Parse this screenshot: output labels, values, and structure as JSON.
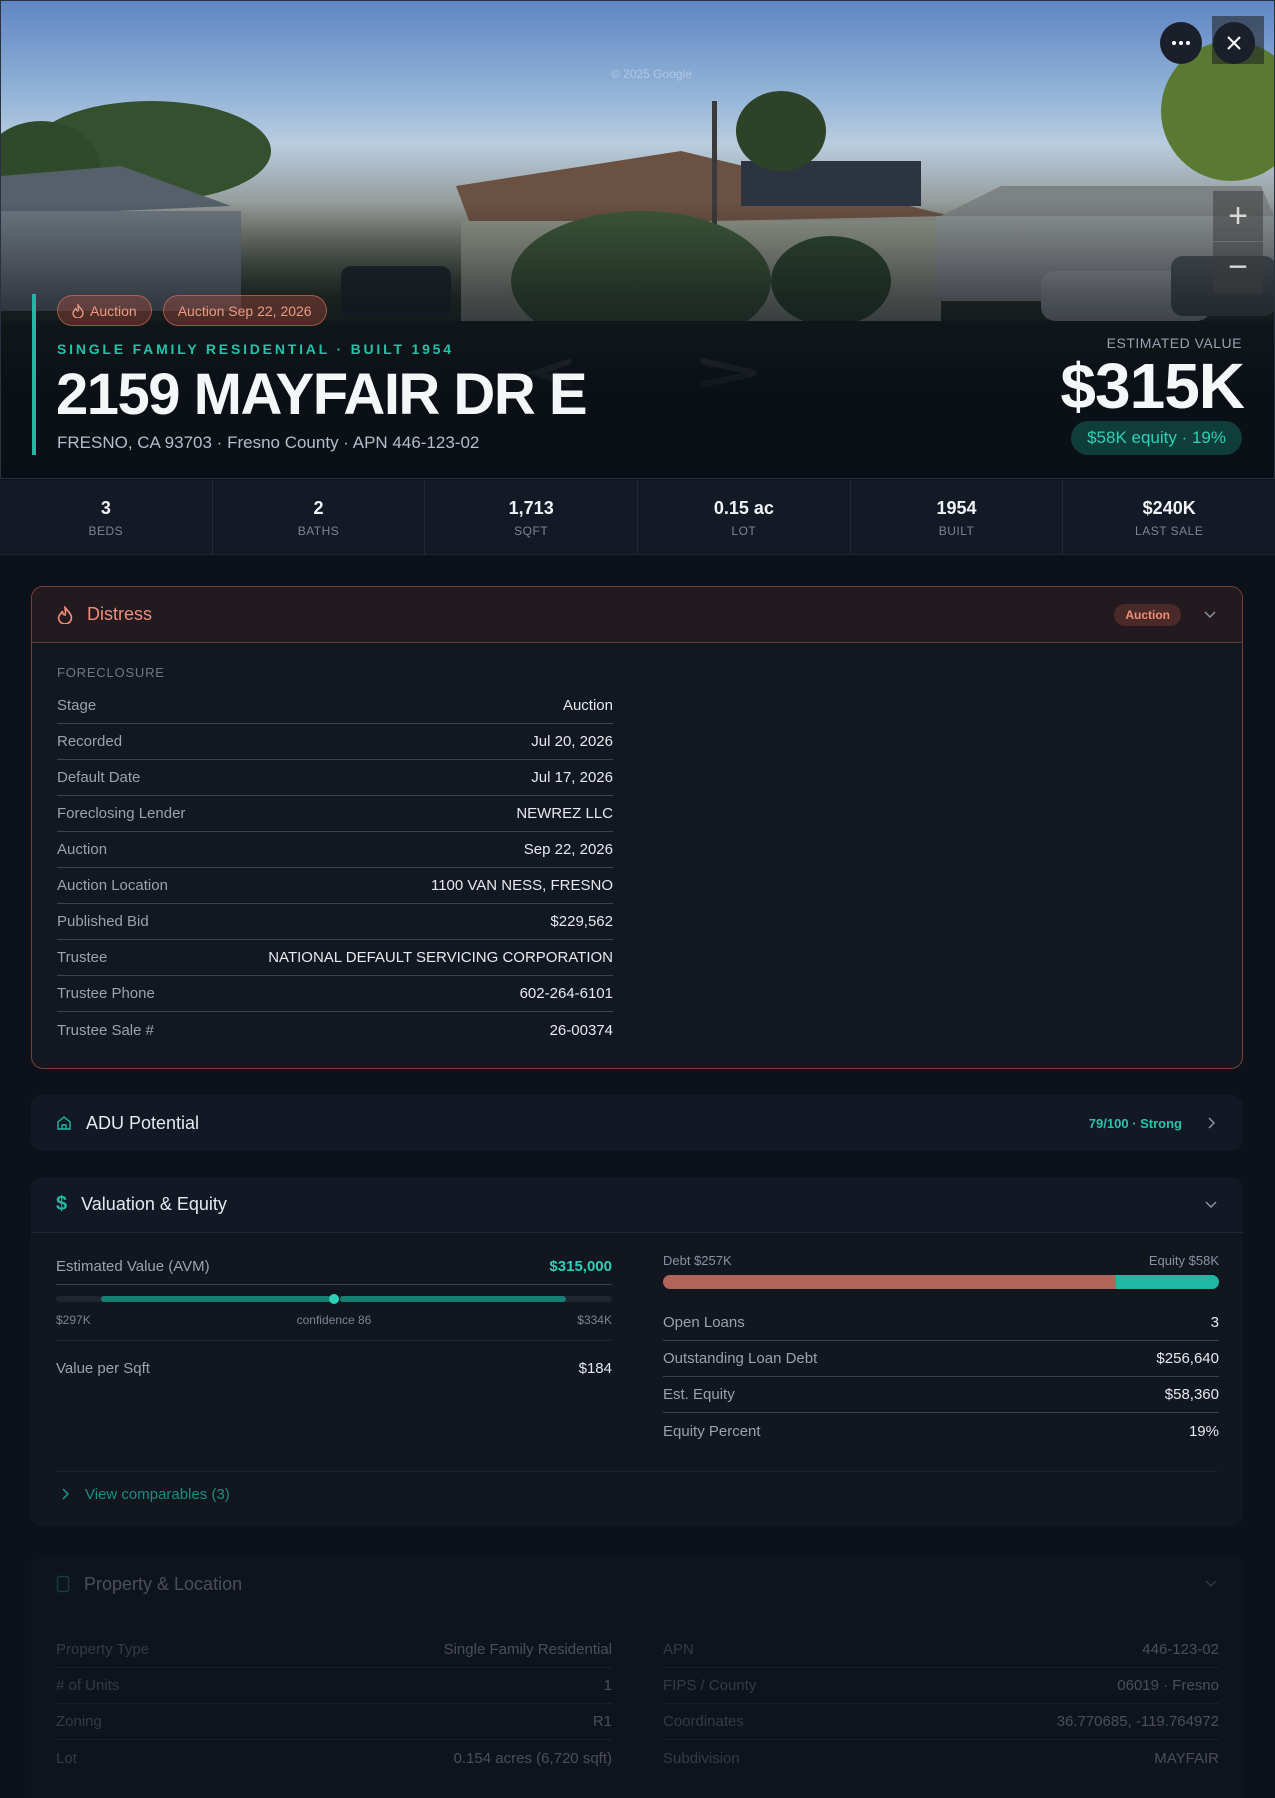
{
  "hero": {
    "copyright": "© 2025 Google",
    "chips": [
      "Auction",
      "Auction Sep 22, 2026"
    ],
    "subtitle": "SINGLE FAMILY RESIDENTIAL · BUILT 1954",
    "title": "2159 MAYFAIR DR E",
    "address": "FRESNO, CA 93703 · Fresno County · APN 446-123-02",
    "estimated_label": "ESTIMATED VALUE",
    "estimated_value": "$315K",
    "equity_pill": "$58K equity · 19%",
    "icons": [
      "more-icon",
      "close-icon",
      "zoom-in-icon",
      "zoom-out-icon",
      "flame-icon"
    ]
  },
  "stats": [
    {
      "value": "3",
      "label": "BEDS"
    },
    {
      "value": "2",
      "label": "BATHS"
    },
    {
      "value": "1,713",
      "label": "SQFT"
    },
    {
      "value": "0.15 ac",
      "label": "LOT"
    },
    {
      "value": "1954",
      "label": "BUILT"
    },
    {
      "value": "$240K",
      "label": "LAST SALE"
    }
  ],
  "distress": {
    "title": "Distress",
    "badge": "Auction",
    "section_label": "FORECLOSURE",
    "rows": [
      {
        "k": "Stage",
        "v": "Auction",
        "accent": "red"
      },
      {
        "k": "Recorded",
        "v": "Jul 20, 2026"
      },
      {
        "k": "Default Date",
        "v": "Jul 17, 2026"
      },
      {
        "k": "Foreclosing Lender",
        "v": "NEWREZ LLC"
      },
      {
        "k": "Auction",
        "v": "Sep 22, 2026",
        "accent": "red"
      },
      {
        "k": "Auction Location",
        "v": "1100 VAN NESS, FRESNO"
      },
      {
        "k": "Published Bid",
        "v": "$229,562",
        "accent": "red"
      },
      {
        "k": "Trustee",
        "v": "NATIONAL DEFAULT SERVICING CORPORATION"
      },
      {
        "k": "Trustee Phone",
        "v": "602-264-6101"
      },
      {
        "k": "Trustee Sale #",
        "v": "26-00374"
      }
    ]
  },
  "adu": {
    "title": "ADU Potential",
    "score": "79/100 · Strong"
  },
  "valuation": {
    "title": "Valuation & Equity",
    "avm_label": "Estimated Value (AVM)",
    "avm_value": "$315,000",
    "range_low": "$297K",
    "range_mid": "confidence 86",
    "range_high": "$334K",
    "value_per_sqft_label": "Value per Sqft",
    "value_per_sqft": "$184",
    "debt_label": "Debt $257K",
    "equity_label": "Equity $58K",
    "equity_fraction": 0.185,
    "rows": [
      {
        "k": "Open Loans",
        "v": "3"
      },
      {
        "k": "Outstanding Loan Debt",
        "v": "$256,640"
      },
      {
        "k": "Est. Equity",
        "v": "$58,360",
        "accent": "green"
      },
      {
        "k": "Equity Percent",
        "v": "19%"
      }
    ],
    "comparables_link": "View comparables (3)"
  },
  "property": {
    "title": "Property & Location",
    "left": [
      {
        "k": "Property Type",
        "v": "Single Family Residential"
      },
      {
        "k": "# of Units",
        "v": "1"
      },
      {
        "k": "Zoning",
        "v": "R1"
      },
      {
        "k": "Lot",
        "v": "0.154 acres (6,720 sqft)"
      }
    ],
    "right": [
      {
        "k": "APN",
        "v": "446-123-02"
      },
      {
        "k": "FIPS / County",
        "v": "06019 · Fresno"
      },
      {
        "k": "Coordinates",
        "v": "36.770685, -119.764972"
      },
      {
        "k": "Subdivision",
        "v": "MAYFAIR"
      }
    ]
  },
  "colors": {
    "accent_teal": "#1fb8a3",
    "distress_red": "#ee8a6e",
    "debt_bar": "#b0645a",
    "equity_bar": "#1fb8a3"
  }
}
